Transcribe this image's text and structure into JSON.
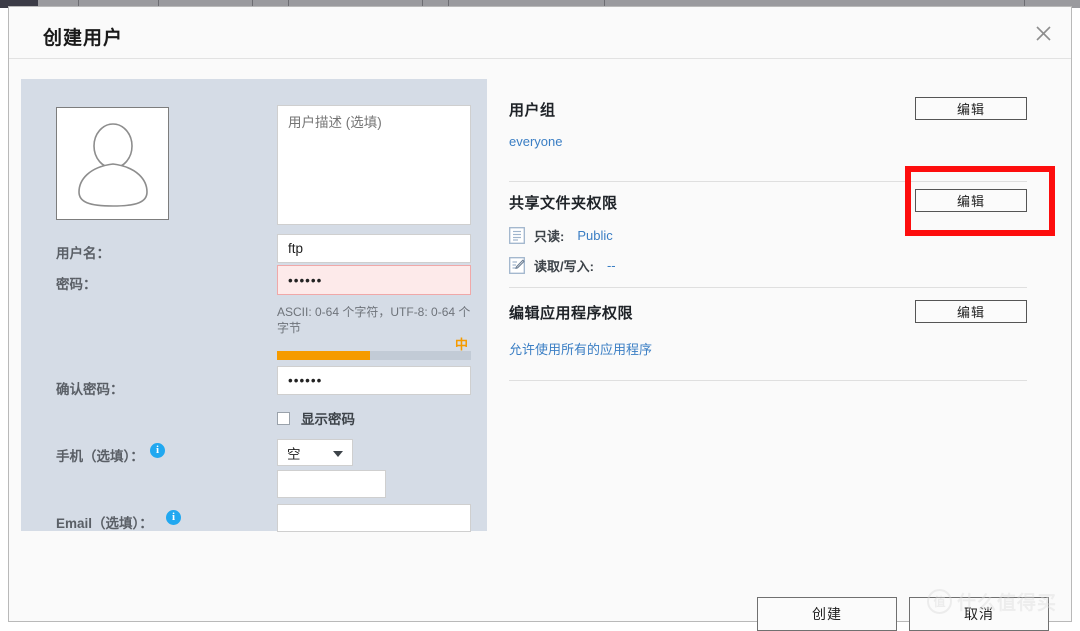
{
  "window": {
    "title": "创建用户",
    "close_icon": "close-icon"
  },
  "left_form": {
    "avatar_icon": "user-avatar-icon",
    "description": {
      "placeholder": "用户描述 (选填)",
      "value": ""
    },
    "username": {
      "label": "用户名：",
      "value": "ftp"
    },
    "password": {
      "label": "密码：",
      "value": "••••••",
      "hint": "ASCII: 0-64 个字符，UTF-8: 0-64 个字节",
      "strength_label": "中",
      "strength_percent": 48,
      "strength_color": "#f59b00",
      "error_bg": "#fdeaea"
    },
    "confirm_password": {
      "label": "确认密码：",
      "value": "••••••"
    },
    "show_password": {
      "label": "显示密码",
      "checked": false
    },
    "mobile": {
      "label": "手机（选填）：",
      "info_icon": "info-icon",
      "country_value": "空",
      "number_value": ""
    },
    "email": {
      "label": "Email（选填）：",
      "info_icon": "info-icon",
      "value": ""
    }
  },
  "right_panel": {
    "user_group": {
      "title": "用户组",
      "edit_label": "编辑",
      "link": "everyone"
    },
    "shared_folder": {
      "title": "共享文件夹权限",
      "edit_label": "编辑",
      "highlighted": true,
      "highlight_color": "#fd0d0d",
      "permissions": [
        {
          "icon": "read-only-document-icon",
          "label": "只读:",
          "value": "Public"
        },
        {
          "icon": "read-write-document-icon",
          "label": "读取/写入:",
          "value": "--"
        }
      ]
    },
    "app_permission": {
      "title": "编辑应用程序权限",
      "edit_label": "编辑",
      "link": "允许使用所有的应用程序"
    }
  },
  "footer": {
    "create_label": "创建",
    "cancel_label": "取消"
  },
  "watermark": {
    "logo_text": "值",
    "text": "什么值得买"
  }
}
